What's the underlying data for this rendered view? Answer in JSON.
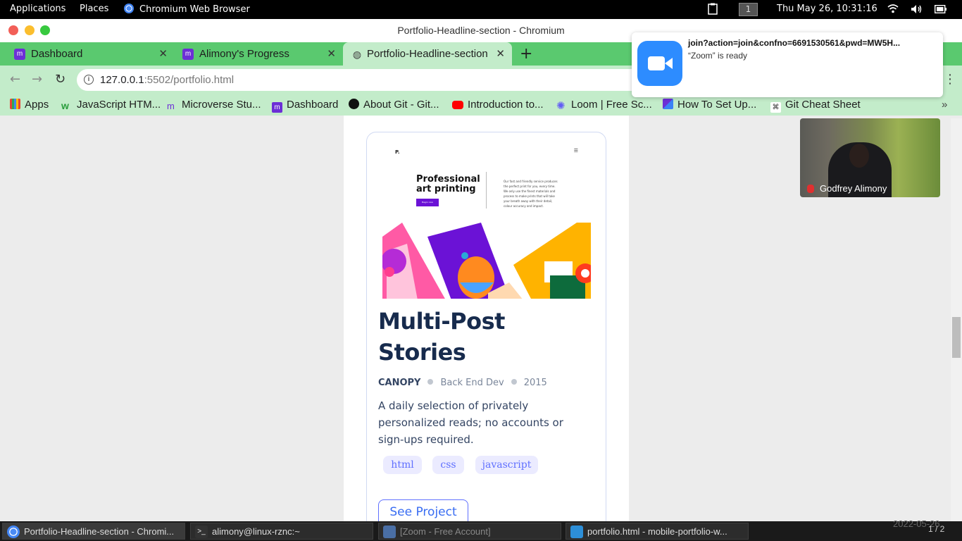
{
  "system_bar": {
    "applications": "Applications",
    "places": "Places",
    "active_app": "Chromium Web Browser",
    "workspace": "1",
    "datetime": "Thu May 26, 10:31:16"
  },
  "window": {
    "title": "Portfolio-Headline-section - Chromium"
  },
  "tabs": [
    {
      "label": "Dashboard"
    },
    {
      "label": "Alimony's Progress"
    },
    {
      "label": "Portfolio-Headline-section",
      "active": true
    }
  ],
  "address": {
    "host": "127.0.0.1",
    "rest": ":5502/portfolio.html"
  },
  "bookmarks": [
    {
      "label": "Apps"
    },
    {
      "label": "JavaScript HTM..."
    },
    {
      "label": "Microverse Stu..."
    },
    {
      "label": "Dashboard"
    },
    {
      "label": "About Git - Git..."
    },
    {
      "label": "Introduction to..."
    },
    {
      "label": "Loom | Free Sc..."
    },
    {
      "label": "How To Set Up..."
    },
    {
      "label": "Git Cheat Sheet"
    }
  ],
  "project": {
    "thumb_brand": "P.",
    "thumb_heading_1": "Professional",
    "thumb_heading_2": "art printing",
    "thumb_button": "Begin now",
    "thumb_desc": "Our fast and friendly service produces the perfect print for you, every time. We only use the finest materials and process to make prints that will take your breath away with their detail, colour accuracy and impact.",
    "title_1": "Multi-Post",
    "title_2": "Stories",
    "client": "CANOPY",
    "role": "Back End Dev",
    "year": "2015",
    "description": "A daily selection of privately personalized reads; no accounts or sign-ups required.",
    "tags": [
      "html",
      "css",
      "javascript"
    ],
    "button": "See Project"
  },
  "notification": {
    "title": "join?action=join&confno=6691530561&pwd=MW5H...",
    "subtitle": "“Zoom” is ready"
  },
  "video": {
    "name": "Godfrey Alimony"
  },
  "taskbar": {
    "items": [
      {
        "label": "Portfolio-Headline-section - Chromi..."
      },
      {
        "label": "alimony@linux-rznc:~"
      },
      {
        "label": "[Zoom - Free Account]"
      },
      {
        "label": "portfolio.html - mobile-portfolio-w..."
      }
    ],
    "pager": "1 / 2",
    "stamp": "2022-05-26"
  },
  "colors": {
    "accent": "#6070ff",
    "tab_strip": "#5ac96f",
    "title_text": "#172b4d"
  }
}
